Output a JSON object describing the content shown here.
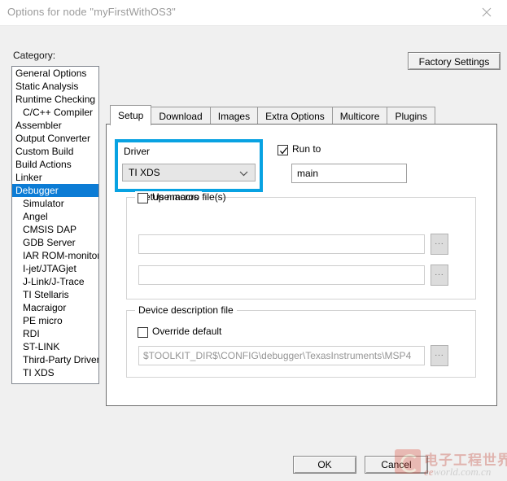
{
  "window": {
    "title": "Options for node \"myFirstWithOS3\"",
    "close_icon": "close-icon"
  },
  "category": {
    "label": "Category:",
    "selected": "Debugger",
    "items": [
      {
        "label": "General Options",
        "indent": false
      },
      {
        "label": "Static Analysis",
        "indent": false
      },
      {
        "label": "Runtime Checking",
        "indent": false
      },
      {
        "label": "C/C++ Compiler",
        "indent": true
      },
      {
        "label": "Assembler",
        "indent": false
      },
      {
        "label": "Output Converter",
        "indent": false
      },
      {
        "label": "Custom Build",
        "indent": false
      },
      {
        "label": "Build Actions",
        "indent": false
      },
      {
        "label": "Linker",
        "indent": false
      },
      {
        "label": "Debugger",
        "indent": false
      },
      {
        "label": "Simulator",
        "indent": true
      },
      {
        "label": "Angel",
        "indent": true
      },
      {
        "label": "CMSIS DAP",
        "indent": true
      },
      {
        "label": "GDB Server",
        "indent": true
      },
      {
        "label": "IAR ROM-monitor",
        "indent": true
      },
      {
        "label": "I-jet/JTAGjet",
        "indent": true
      },
      {
        "label": "J-Link/J-Trace",
        "indent": true
      },
      {
        "label": "TI Stellaris",
        "indent": true
      },
      {
        "label": "Macraigor",
        "indent": true
      },
      {
        "label": "PE micro",
        "indent": true
      },
      {
        "label": "RDI",
        "indent": true
      },
      {
        "label": "ST-LINK",
        "indent": true
      },
      {
        "label": "Third-Party Driver",
        "indent": true
      },
      {
        "label": "TI XDS",
        "indent": true
      }
    ]
  },
  "toolbar": {
    "factory_settings_label": "Factory Settings"
  },
  "tabs": [
    {
      "label": "Setup",
      "active": true
    },
    {
      "label": "Download",
      "active": false
    },
    {
      "label": "Images",
      "active": false
    },
    {
      "label": "Extra Options",
      "active": false
    },
    {
      "label": "Multicore",
      "active": false
    },
    {
      "label": "Plugins",
      "active": false
    }
  ],
  "setup": {
    "driver": {
      "label": "Driver",
      "value": "TI XDS",
      "dropdown_icon": "chevron-down-icon",
      "highlight_color": "#08a2e2"
    },
    "run_to": {
      "label": "Run to",
      "checked": true,
      "value": "main",
      "placeholder": ""
    },
    "setup_macros": {
      "title": "Setup macros",
      "use_macro_files": {
        "label": "Use macro file(s)",
        "checked": false
      },
      "field_1": {
        "value": "",
        "placeholder": ""
      },
      "field_2": {
        "value": "",
        "placeholder": ""
      },
      "browse_label": "..."
    },
    "device_description": {
      "title": "Device description file",
      "override_default": {
        "label": "Override default",
        "checked": false
      },
      "path": "$TOOLKIT_DIR$\\CONFIG\\debugger\\TexasInstruments\\MSP4",
      "browse_label": "..."
    }
  },
  "footer": {
    "ok_label": "OK",
    "cancel_label": "Cancel"
  },
  "watermark": {
    "chinese": "电子工程世界",
    "domain_prefix": "ee",
    "domain_suffix": "world.com.cn"
  },
  "colors": {
    "selection_blue": "#0c7cd5",
    "annotation_blue": "#08a2e2",
    "dialog_bg": "#f0f0f0",
    "panel_bg": "#ffffff",
    "watermark_red": "#c0392b"
  }
}
